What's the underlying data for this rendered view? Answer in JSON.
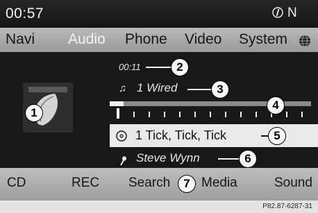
{
  "status": {
    "time": "00:57",
    "compass_label": "N"
  },
  "menu": {
    "items": [
      {
        "label": "Navi"
      },
      {
        "label": "Audio"
      },
      {
        "label": "Phone"
      },
      {
        "label": "Video"
      },
      {
        "label": "System"
      }
    ],
    "active": "Audio"
  },
  "player": {
    "elapsed": "00:11",
    "source": "1 Wired",
    "track": "1 Tick, Tick, Tick",
    "artist": "Steve Wynn",
    "progress_fraction": 0.07
  },
  "callouts": [
    "1",
    "2",
    "3",
    "4",
    "5",
    "6",
    "7"
  ],
  "bottom": {
    "items": [
      {
        "label": "CD"
      },
      {
        "label": "REC"
      },
      {
        "label": "Search"
      },
      {
        "label": "Media"
      },
      {
        "label": "Sound"
      }
    ]
  },
  "caption": "P82.87-6287-31"
}
